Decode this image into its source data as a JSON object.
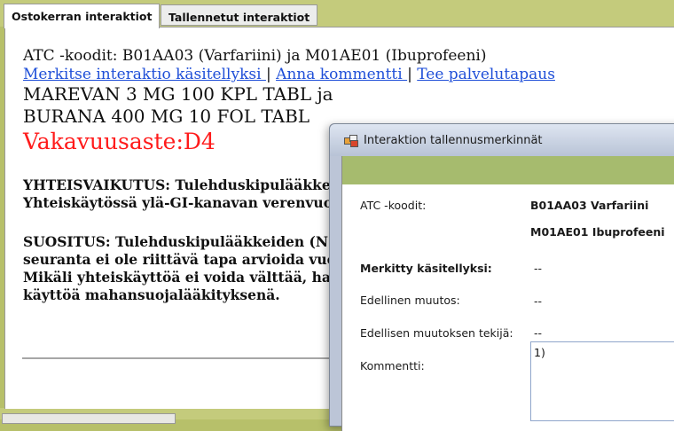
{
  "tabs": [
    {
      "label": "Ostokerran interaktiot",
      "active": true
    },
    {
      "label": "Tallennetut interaktiot",
      "active": false
    }
  ],
  "main": {
    "atc_line": "ATC -koodit: B01AA03 (Varfariini) ja M01AE01 (Ibuprofeeni)",
    "links": [
      "Merkitse interaktio käsitellyksi ",
      "Anna kommentti ",
      "Tee palvelutapaus"
    ],
    "link_separator": "|",
    "drug1": "MAREVAN 3 MG 100 KPL TABL ja",
    "drug2": "BURANA 400 MG 10 FOL TABL",
    "severity": "Vakavuusaste:D4",
    "effect_lines": [
      "YHTEISVAIKUTUS: Tulehduskipulääkke",
      "Yhteiskäytössä ylä-GI-kanavan verenvuod"
    ],
    "recommendation_lines": [
      "SUOSITUS: Tulehduskipulääkkeiden (NS",
      "seuranta ei ole riittävä tapa arvioida vuoto",
      "Mikäli yhteiskäyttöä ei voida välttää, hark",
      "käyttöä mahansuojalääkityksenä."
    ]
  },
  "dialog": {
    "title": "Interaktion tallennusmerkinnät",
    "atc_label": "ATC -koodit:",
    "atc_value1": "B01AA03 Varfariini",
    "atc_value2": "M01AE01 Ibuprofeeni",
    "processed_label": "Merkitty käsitellyksi:",
    "processed_value": "--",
    "prev_change_label": "Edellinen muutos:",
    "prev_change_value": "--",
    "prev_author_label": "Edellisen muutoksen tekijä:",
    "prev_author_value": "--",
    "comment_label": "Kommentti:",
    "comment_value": "1)"
  },
  "colors": {
    "accent_olive": "#c4cb7c",
    "dialog_band": "#a6bb6e",
    "link": "#1f4fd8",
    "severity": "#ff1b1b"
  }
}
